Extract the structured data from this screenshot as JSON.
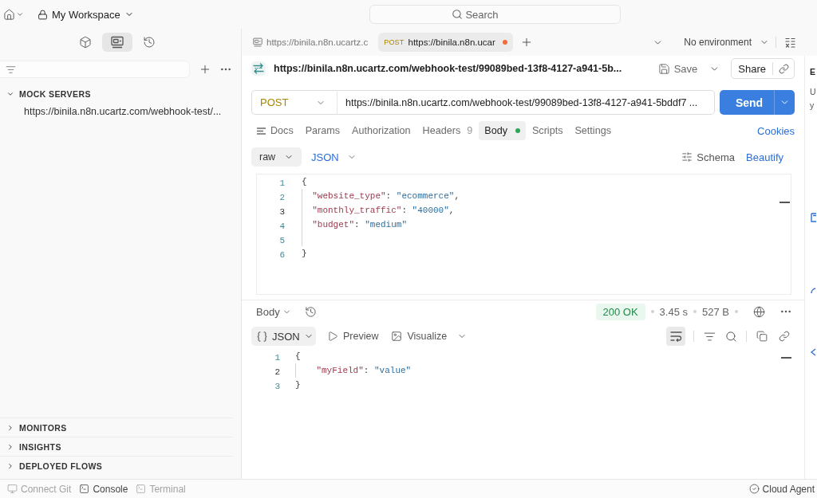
{
  "top_bar": {
    "workspace": "My Workspace",
    "search": {
      "placeholder": "Search"
    }
  },
  "sidebar": {
    "views": [
      {
        "kind": "collections",
        "selected": false
      },
      {
        "kind": "mock_servers",
        "selected": true
      },
      {
        "kind": "history",
        "selected": false
      }
    ],
    "sections": [
      {
        "title": "MOCK SERVERS",
        "expanded": true,
        "items": [
          "https://binila.n8n.ucartz.com/webhook-test/..."
        ]
      }
    ],
    "footer_sections": [
      {
        "title": "MONITORS",
        "expanded": false
      },
      {
        "title": "INSIGHTS",
        "expanded": false
      },
      {
        "title": "DEPLOYED FLOWS",
        "expanded": false
      }
    ]
  },
  "tabs": [
    {
      "kind": "mock",
      "label": "https://binila.n8n.ucartz.c",
      "selected": false,
      "unsaved": false
    },
    {
      "kind": "request",
      "method": "POST",
      "label": "https://binila.n8n.ucar",
      "selected": true,
      "unsaved": true
    }
  ],
  "environment": "No environment",
  "request": {
    "title": "https://binila.n8n.ucartz.com/webhook-test/99089bed-13f8-4127-a941-5b...",
    "save": "Save",
    "share": "Share",
    "method": "POST",
    "url": "https://binila.n8n.ucartz.com/webhook-test/99089bed-13f8-4127-a941-5bddf7 ...",
    "send": "Send",
    "tabs": [
      {
        "kind": "icon",
        "label": "Docs",
        "selected": false
      },
      {
        "kind": "plain",
        "label": "Params",
        "selected": false
      },
      {
        "kind": "plain",
        "label": "Authorization",
        "selected": false
      },
      {
        "kind": "count",
        "label": "Headers",
        "count": "9",
        "selected": false
      },
      {
        "kind": "dot",
        "label": "Body",
        "selected": true
      },
      {
        "kind": "plain",
        "label": "Scripts",
        "selected": false
      },
      {
        "kind": "plain",
        "label": "Settings",
        "selected": false
      }
    ],
    "cookies": "Cookies",
    "body_mode": "raw",
    "body_language": "JSON",
    "schema": "Schema",
    "beautify": "Beautify",
    "editor": {
      "lines": [
        {
          "number": "1",
          "active": false,
          "tokens": [
            {
              "kind": "punct",
              "text": "{"
            }
          ],
          "children": [
            {
              "number": "2",
              "active": false,
              "tokens": [
                {
                  "kind": "key",
                  "text": "\"website_type\""
                },
                {
                  "kind": "punct",
                  "text": ": "
                },
                {
                  "kind": "string",
                  "text": "\"ecommerce\""
                },
                {
                  "kind": "punct",
                  "text": ","
                }
              ]
            },
            {
              "number": "3",
              "active": true,
              "tokens": [
                {
                  "kind": "key",
                  "text": "\"monthly_traffic\""
                },
                {
                  "kind": "punct",
                  "text": ": "
                },
                {
                  "kind": "string",
                  "text": "\"40000\""
                },
                {
                  "kind": "punct",
                  "text": ","
                }
              ]
            },
            {
              "number": "4",
              "active": false,
              "tokens": [
                {
                  "kind": "key",
                  "text": "\"budget\""
                },
                {
                  "kind": "punct",
                  "text": ": "
                },
                {
                  "kind": "string",
                  "text": "\"medium\""
                }
              ]
            },
            {
              "number": "5",
              "active": false
            }
          ]
        },
        {
          "number": "6",
          "active": false,
          "tokens": [
            {
              "kind": "punct",
              "text": "}"
            }
          ]
        }
      ]
    }
  },
  "response": {
    "view": "Body",
    "status": "200 OK",
    "time": "3.45 s",
    "size": "527 B",
    "format": "JSON",
    "preview": "Preview",
    "visualize": "Visualize",
    "wrap_lines": true,
    "editor": {
      "lines": [
        {
          "number": "1",
          "active": false,
          "tokens": [
            {
              "kind": "punct",
              "text": "{"
            }
          ],
          "children": [
            {
              "number": "2",
              "active": true,
              "tokens": [
                {
                  "kind": "key",
                  "text": "\"myField\""
                },
                {
                  "kind": "punct",
                  "text": ": "
                },
                {
                  "kind": "string",
                  "text": "\"value\""
                }
              ]
            }
          ]
        },
        {
          "number": "3",
          "active": false,
          "tokens": [
            {
              "kind": "punct",
              "text": "}"
            }
          ]
        }
      ]
    }
  },
  "right_panel": {
    "title": "E",
    "lines": [
      "U",
      "y"
    ]
  },
  "status_bar": {
    "items": [
      {
        "kind": "git",
        "label": "Connect Git",
        "disabled": true
      },
      {
        "kind": "console",
        "label": "Console",
        "disabled": false
      },
      {
        "kind": "terminal",
        "label": "Terminal",
        "disabled": true
      }
    ],
    "agent": "Cloud Agent"
  }
}
